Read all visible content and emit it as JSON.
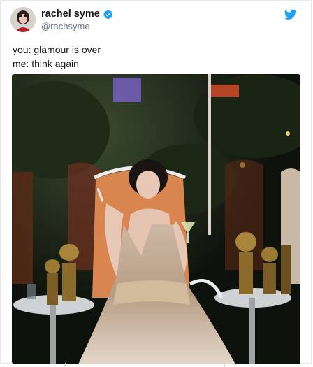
{
  "tweet": {
    "author": {
      "display_name": "rachel syme",
      "handle": "@rachsyme",
      "verified": true,
      "avatar_icon": "user-avatar"
    },
    "logo_icon": "twitter-bird-icon",
    "brand_color": "#1da1f2",
    "lines": [
      "you: glamour is over",
      "me: think again"
    ],
    "media": {
      "type": "photo",
      "icon": "photo-image"
    }
  }
}
